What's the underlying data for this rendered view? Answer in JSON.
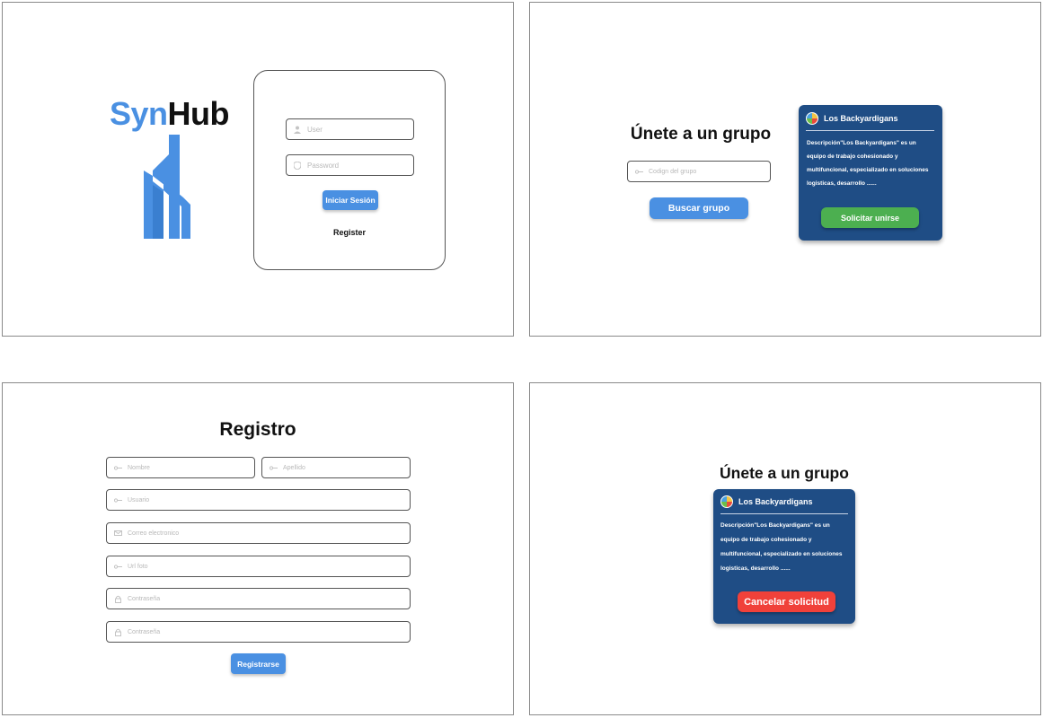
{
  "login": {
    "logo_syn": "Syn",
    "logo_hub": "Hub",
    "user_placeholder": "User",
    "password_placeholder": "Password",
    "login_button": "Iniciar Sesión",
    "register_link": "Register"
  },
  "join_search": {
    "title": "Únete a un grupo",
    "code_placeholder": "Codign del grupo",
    "search_button": "Buscar grupo",
    "card": {
      "group_name": "Los Backyardigans",
      "description_lines": [
        "Descripción\"Los Backyardigans\" es un",
        "equipo de trabajo cohesionado y",
        "multifuncional, especializado en soluciones",
        "logisticas, desarrollo ......"
      ],
      "join_button": "Solicitar unirse"
    }
  },
  "register": {
    "title": "Registro",
    "nombre_placeholder": "Nombre",
    "apellido_placeholder": "Apellido",
    "usuario_placeholder": "Usuario",
    "correo_placeholder": "Correo electronico",
    "foto_placeholder": "Url foto",
    "password_placeholder": "Contraseña",
    "password_confirm_placeholder": "Contraseña",
    "submit_button": "Registrarse"
  },
  "join_pending": {
    "title": "Únete a un grupo",
    "card": {
      "group_name": "Los Backyardigans",
      "description_lines": [
        "Descripción\"Los Backyardigans\" es un",
        "equipo de trabajo cohesionado y",
        "multifuncional, especializado en soluciones",
        "logisticas, desarrollo ......"
      ],
      "cancel_button": "Cancelar solicitud"
    }
  },
  "colors": {
    "brand_blue": "#4a90e2",
    "card_navy": "#1f4d85",
    "join_green": "#4caf50",
    "cancel_red": "#f0413a"
  }
}
